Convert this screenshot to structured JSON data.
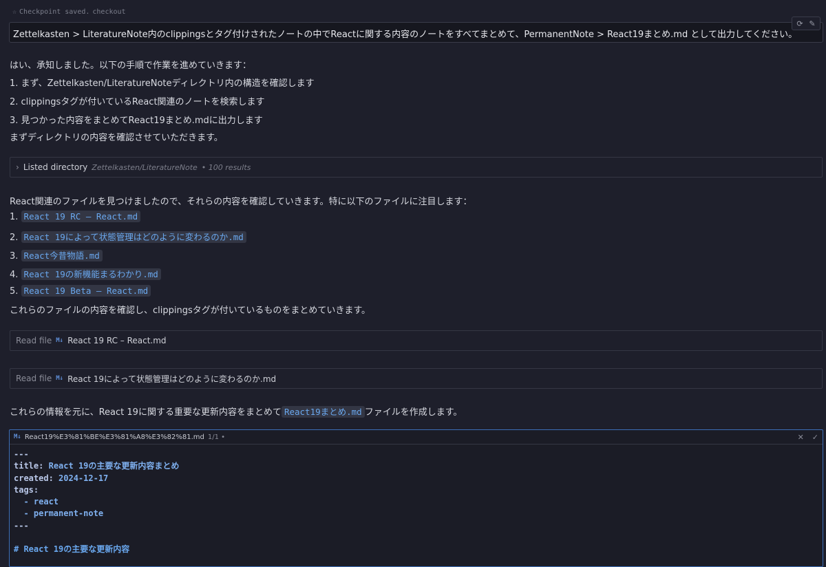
{
  "checkpoint": {
    "text": "Checkpoint saved.",
    "link": "checkout"
  },
  "prompt": "Zettelkasten > LiteratureNote内のclippingsとタグ付けされたノートの中でReactに関する内容のノートをすべてまとめて、PermanentNote > React19まとめ.md として出力してください。",
  "intro": {
    "line1": "はい、承知しました。以下の手順で作業を進めていきます：",
    "step1": "1. まず、Zettelkasten/LiteratureNoteディレクトリ内の構造を確認します",
    "step2": "2. clippingsタグが付いているReact関連のノートを検索します",
    "step3": "3. 見つかった内容をまとめてReact19まとめ.mdに出力します",
    "line2": "まずディレクトリの内容を確認させていただきます。"
  },
  "listed": {
    "label": "Listed directory",
    "path": "Zettelkasten/LiteratureNote",
    "count": "• 100 results"
  },
  "found": {
    "intro": "React関連のファイルを見つけましたので、それらの内容を確認していきます。特に以下のファイルに注目します：",
    "files": [
      {
        "num": "1.",
        "name": "React 19 RC – React.md"
      },
      {
        "num": "2.",
        "name": "React 19によって状態管理はどのように変わるのか.md"
      },
      {
        "num": "3.",
        "name": "React今昔物語.md"
      },
      {
        "num": "4.",
        "name": "React 19の新機能まるわかり.md"
      },
      {
        "num": "5.",
        "name": "React 19 Beta – React.md"
      }
    ],
    "outro": "これらのファイルの内容を確認し、clippingsタグが付いているものをまとめていきます。"
  },
  "reads": [
    {
      "label": "Read file",
      "icon": "M↓",
      "file": "React 19 RC – React.md"
    },
    {
      "label": "Read file",
      "icon": "M↓",
      "file": "React 19によって状態管理はどのように変わるのか.md"
    }
  ],
  "summary": {
    "before": "これらの情報を元に、React 19に関する重要な更新内容をまとめて",
    "file": "React19まとめ.md",
    "after": "ファイルを作成します。"
  },
  "editor": {
    "icon": "M↓",
    "filename": "React19%E3%81%BE%E3%81%A8%E3%82%81.md",
    "count": "1/1 •",
    "lines": {
      "l1": "---",
      "title_key": "title:",
      "title_val": "React 19の主要な更新内容まとめ",
      "created_key": "created:",
      "created_val": "2024-12-17",
      "tags_key": "tags:",
      "tag1": "  - react",
      "tag2": "  - permanent-note",
      "l8": "---",
      "heading": "# React 19の主要な更新内容"
    }
  },
  "colors": {
    "background": "#1e1f2b",
    "accent": "#6aa8ef",
    "editor_border": "#3d6fb8"
  }
}
